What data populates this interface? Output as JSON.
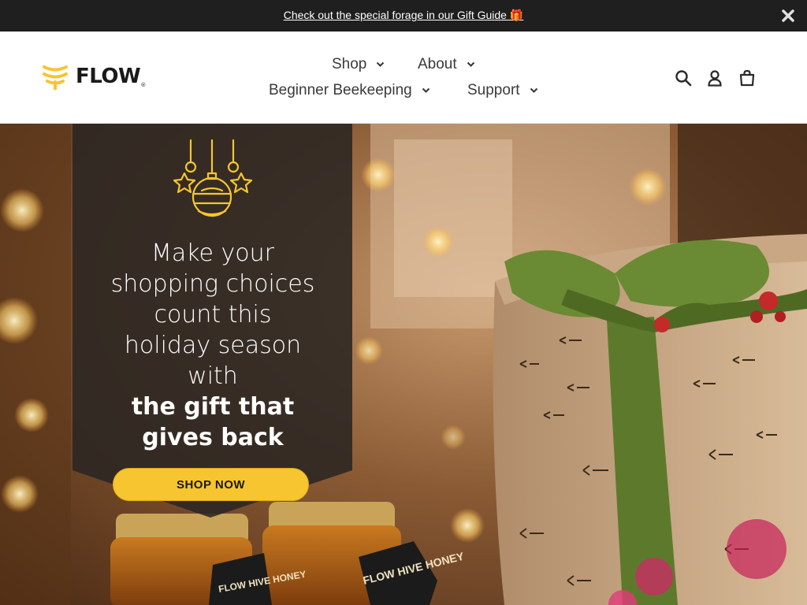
{
  "announcement": {
    "text": "Check out the special forage in our Gift Guide 🎁",
    "close_icon": "close-icon"
  },
  "header": {
    "logo_text": "FLOW",
    "logo_reg": "®",
    "nav": [
      {
        "label": "Shop"
      },
      {
        "label": "About"
      },
      {
        "label": "Beginner Beekeeping"
      },
      {
        "label": "Support"
      }
    ],
    "icons": [
      "search-icon",
      "account-icon",
      "cart-icon"
    ]
  },
  "hero": {
    "headline_lines": [
      "Make your",
      "shopping choices",
      "count this",
      "holiday season",
      "with"
    ],
    "headline_bold_lines": [
      "the gift that",
      "gives back"
    ],
    "cta_label": "SHOP NOW",
    "jar_labels": [
      "FLOW HIVE HONEY",
      "FLOW HIVE HONEY"
    ]
  },
  "colors": {
    "accent": "#f7c530",
    "announcement_bg": "#1f1f1f",
    "panel_bg": "#2a2622",
    "ribbon": "#5d7a2c"
  }
}
